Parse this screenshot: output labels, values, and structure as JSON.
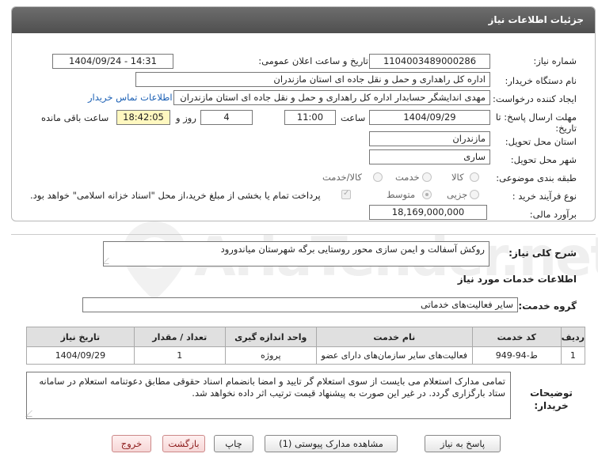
{
  "panel": {
    "title": "جزئیات اطلاعات نیاز"
  },
  "fields": {
    "need_number_label": "شماره نیاز:",
    "need_number": "1104003489000286",
    "announce_label": "تاریخ و ساعت اعلان عمومی:",
    "announce_value": "1404/09/24 - 14:31",
    "buyer_org_label": "نام دستگاه خریدار:",
    "buyer_org": "اداره کل راهداری و حمل و نقل جاده ای استان مازندران",
    "creator_label": "ایجاد کننده درخواست:",
    "creator": "مهدی اندایشگر حسابدار اداره کل راهداری و حمل و نقل جاده ای استان مازندران",
    "contact_link": "اطلاعات تماس خریدار",
    "deadline_label": "مهلت ارسال پاسخ: تا تاریخ:",
    "deadline_date": "1404/09/29",
    "time_label": "ساعت",
    "deadline_time": "11:00",
    "days_value": "4",
    "days_label": "روز و",
    "remaining_time": "18:42:05",
    "remaining_label": "ساعت باقی مانده",
    "province_label": "استان محل تحویل:",
    "province": "مازندران",
    "city_label": "شهر محل تحویل:",
    "city": "ساری",
    "category_label": "طبقه بندی موضوعی:",
    "category_options": [
      "کالا",
      "خدمت",
      "کالا/خدمت"
    ],
    "purchase_type_label": "نوع فرآیند خرید :",
    "purchase_options": [
      "جزیی",
      "متوسط"
    ],
    "payment_note": "پرداخت تمام یا بخشی از مبلغ خرید،از محل \"اسناد خزانه اسلامی\" خواهد بود.",
    "budget_label": "برآورد مالی:",
    "budget": "18,169,000,000"
  },
  "summary": {
    "label": "شرح کلی نیاز:",
    "value": "روکش آسفالت و ایمن سازی محور روستایی برگه شهرستان میاندورود"
  },
  "services": {
    "heading": "اطلاعات خدمات مورد نیاز",
    "group_label": "گروه خدمت:",
    "group_value": "سایر فعالیت‌های خدماتی",
    "columns": [
      "ردیف",
      "کد خدمت",
      "نام خدمت",
      "واحد اندازه گیری",
      "تعداد / مقدار",
      "تاریخ نیاز"
    ],
    "rows": [
      [
        "1",
        "ط-94-949",
        "فعالیت‌های سایر سازمان‌های دارای عضو",
        "پروژه",
        "1",
        "1404/09/29"
      ]
    ]
  },
  "buyer_notes": {
    "label": "توضیحات خریدار:",
    "value": "تمامی مدارک استعلام می بایست از سوی استعلام گر تایید و امضا بانضمام اسناد حقوقی مطابق دعوتنامه استعلام در سامانه ستاد بارگزاری گردد. در غیر این صورت به پیشنهاد قیمت ترتیب اثر داده نخواهد شد."
  },
  "buttons": {
    "reply": "پاسخ به نیاز",
    "attachments": "مشاهده مدارک پیوستی (1)",
    "print": "چاپ",
    "back": "بازگشت",
    "exit": "خروج"
  },
  "watermark": {
    "text": "AriaTender.net"
  }
}
